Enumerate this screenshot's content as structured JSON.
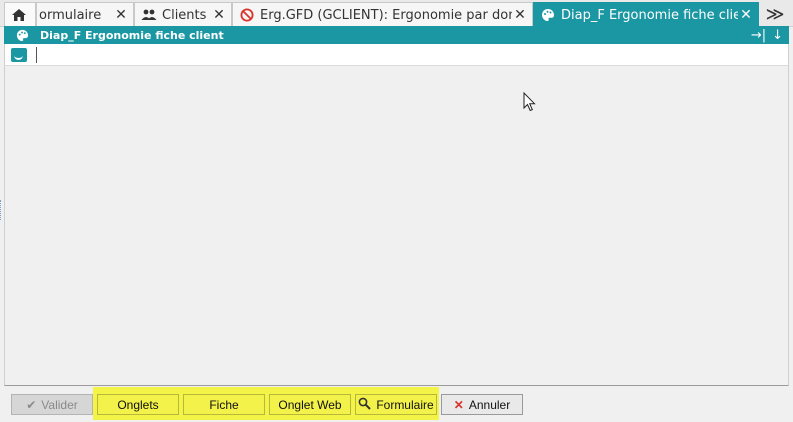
{
  "tabs": [
    {
      "label": "",
      "icon": "home-icon"
    },
    {
      "label": "ormulaire",
      "icon": "",
      "close": "✕"
    },
    {
      "label": "Clients",
      "icon": "users-icon",
      "close": "✕"
    },
    {
      "label": "Erg.GFD (GCLIENT): Ergonomie par doma...",
      "icon": "forbidden-icon",
      "close": "✕"
    },
    {
      "label": "Diap_F Ergonomie fiche client",
      "icon": "palette-icon",
      "close": "✕",
      "active": true
    }
  ],
  "tab_overflow": "≫",
  "panel": {
    "title": "Diap_F Ergonomie fiche client",
    "tool_pin": "→|",
    "tool_download": "↓"
  },
  "buttons": {
    "valider": "Valider",
    "onglets": "Onglets",
    "fiche": "Fiche",
    "onglet_web": "Onglet Web",
    "formulaire": "Formulaire",
    "annuler": "Annuler"
  },
  "colors": {
    "accent": "#1a97a3",
    "highlight": "#f4f448",
    "cancel_icon": "#d9342b"
  }
}
